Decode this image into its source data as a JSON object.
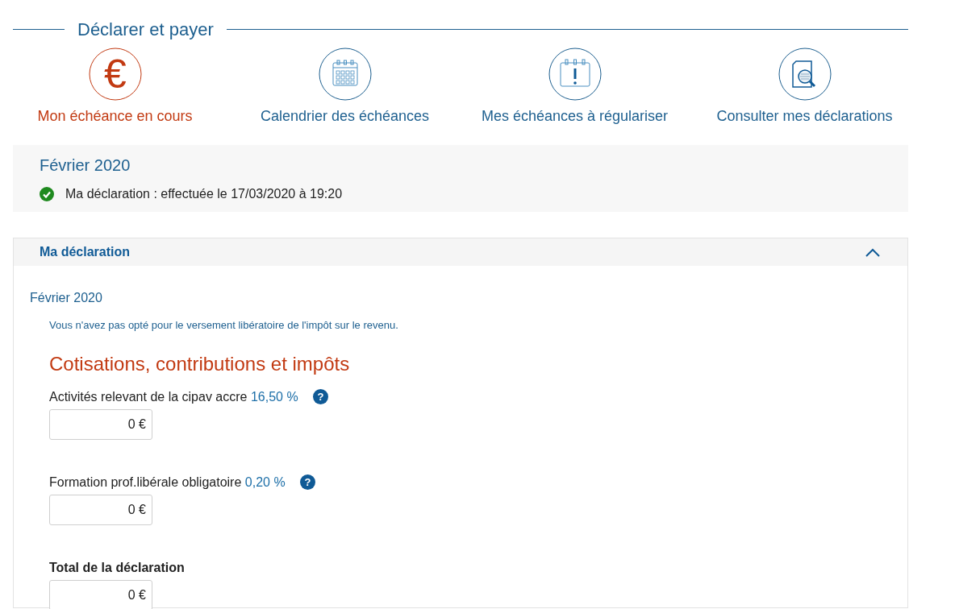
{
  "section_title": "Déclarer et payer",
  "nav": [
    {
      "kind": "euro",
      "glyph": "€",
      "label": "Mon échéance en cours",
      "selected": true
    },
    {
      "kind": "calendar",
      "label": "Calendrier des échéances",
      "selected": false
    },
    {
      "kind": "alert",
      "label": "Mes échéances à régulariser",
      "selected": false
    },
    {
      "kind": "search",
      "label": "Consulter mes déclarations",
      "selected": false
    }
  ],
  "status": {
    "period": "Février 2020",
    "done": true,
    "message": "Ma déclaration : effectuée le 17/03/2020 à 19:20"
  },
  "accordion": {
    "title": "Ma déclaration",
    "expanded": true,
    "period": "Février 2020",
    "note": "Vous n'avez pas opté pour le versement libératoire de l'impôt sur le revenu.",
    "heading": "Cotisations, contributions et impôts",
    "fields": [
      {
        "kind": "rate",
        "label": "Activités relevant de la cipav accre",
        "rate": "16,50 %",
        "help": "?",
        "value": "0 €"
      },
      {
        "kind": "rate",
        "label": "Formation prof.libérale obligatoire",
        "rate": "0,20 %",
        "help": "?",
        "value": "0 €"
      },
      {
        "kind": "total",
        "label": "Total de la déclaration",
        "value": "0 €"
      }
    ]
  }
}
